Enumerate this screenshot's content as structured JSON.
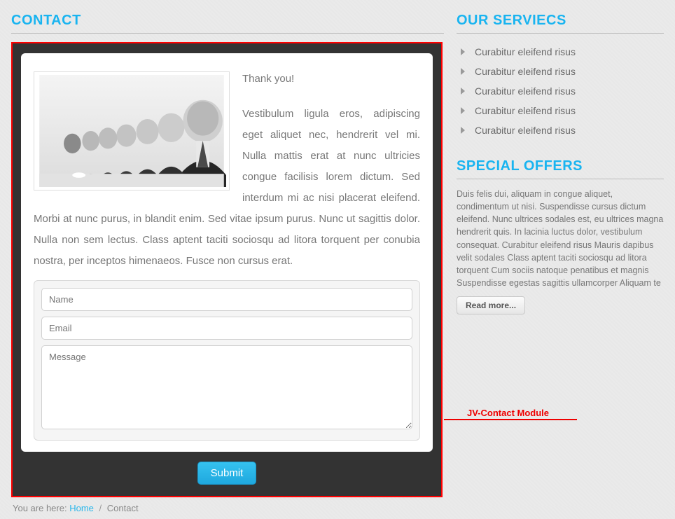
{
  "left": {
    "title": "CONTACT",
    "thanks": "Thank you!",
    "body": "Vestibulum ligula eros, adipiscing eget aliquet nec, hendrerit vel mi. Nulla mattis erat at nunc ultricies congue facilisis lorem dictum. Sed interdum mi ac nisi placerat eleifend. Morbi at nunc purus, in blandit enim. Sed vitae ipsum purus. Nunc ut sagittis dolor. Nulla non sem lectus. Class aptent taciti sociosqu ad litora torquent per conubia nostra, per inceptos himenaeos. Fusce non cursus erat.",
    "form": {
      "name_ph": "Name",
      "email_ph": "Email",
      "message_ph": "Message",
      "submit": "Submit"
    }
  },
  "breadcrumb": {
    "prefix": "You are here:",
    "home": "Home",
    "current": "Contact"
  },
  "right": {
    "services_title": "OUR SERVIECS",
    "services": [
      "Curabitur eleifend risus",
      "Curabitur eleifend risus",
      "Curabitur eleifend risus",
      "Curabitur eleifend risus",
      "Curabitur eleifend risus"
    ],
    "offers_title": "SPECIAL OFFERS",
    "offers_text": "Duis felis dui, aliquam in congue aliquet, condimentum ut nisi. Suspendisse cursus dictum eleifend. Nunc ultrices sodales est, eu ultrices magna hendrerit quis. In lacinia luctus dolor, vestibulum consequat. Curabitur eleifend risus Mauris dapibus velit sodales Class aptent taciti sociosqu ad litora torquent Cum sociis natoque penatibus et magnis Suspendisse egestas sagittis ullamcorper Aliquam te",
    "readmore": "Read more..."
  },
  "annotation": "JV-Contact Module"
}
